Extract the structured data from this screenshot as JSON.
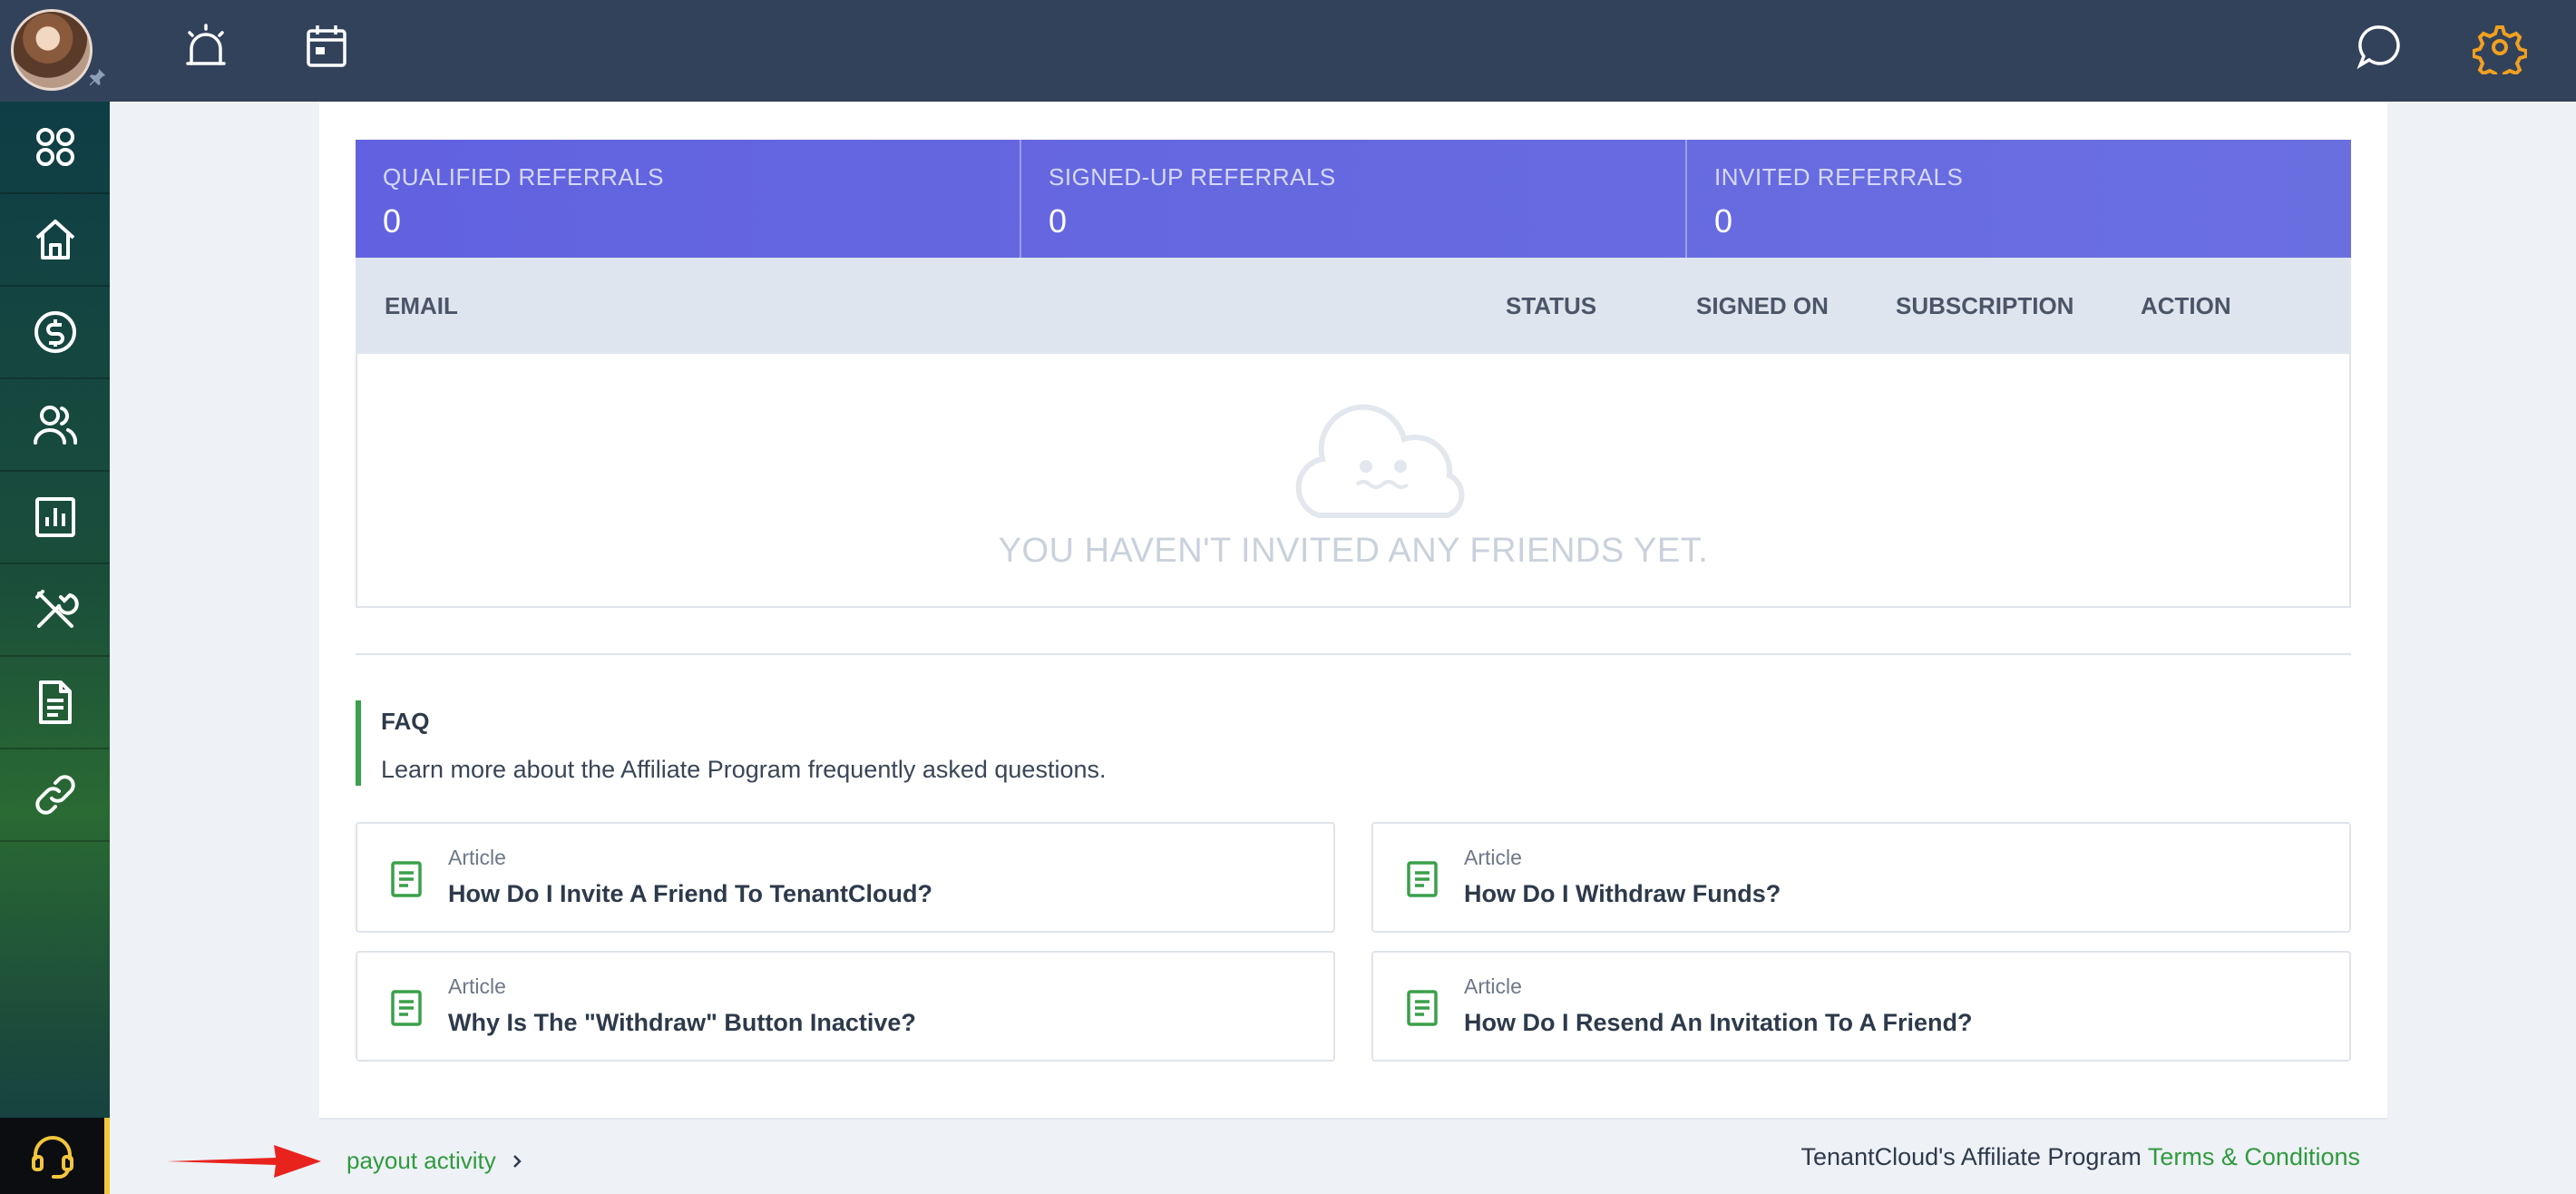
{
  "stats": [
    {
      "label": "QUALIFIED REFERRALS",
      "value": "0"
    },
    {
      "label": "SIGNED-UP REFERRALS",
      "value": "0"
    },
    {
      "label": "INVITED REFERRALS",
      "value": "0"
    }
  ],
  "table": {
    "columns": [
      "EMAIL",
      "STATUS",
      "SIGNED ON",
      "SUBSCRIPTION",
      "ACTION"
    ],
    "empty_message": "YOU HAVEN'T INVITED ANY FRIENDS YET."
  },
  "faq": {
    "title": "FAQ",
    "subtitle": "Learn more about the Affiliate Program frequently asked questions.",
    "articles": [
      {
        "kicker": "Article",
        "title": "How Do I Invite A Friend To TenantCloud?"
      },
      {
        "kicker": "Article",
        "title": "How Do I Withdraw Funds?"
      },
      {
        "kicker": "Article",
        "title": "Why Is The \"Withdraw\" Button Inactive?"
      },
      {
        "kicker": "Article",
        "title": "How Do I Resend An Invitation To A Friend?"
      }
    ]
  },
  "footer": {
    "payout_link": "payout activity",
    "terms_prefix": "TenantCloud's Affiliate Program ",
    "terms_link": "Terms & Conditions"
  },
  "colors": {
    "topbar": "#33425b",
    "stats_banner": "#6262e0",
    "accent_green": "#2f9a3d",
    "settings_orange": "#f0a020",
    "support_border": "#f2c53d"
  },
  "icons": {
    "topbar": [
      "alarm-icon",
      "calendar-icon",
      "chat-icon",
      "gear-icon"
    ],
    "sidebar": [
      "apps-icon",
      "home-icon",
      "dollar-icon",
      "people-icon",
      "report-icon",
      "tools-icon",
      "document-icon",
      "link-icon"
    ],
    "support": "headset-icon"
  }
}
